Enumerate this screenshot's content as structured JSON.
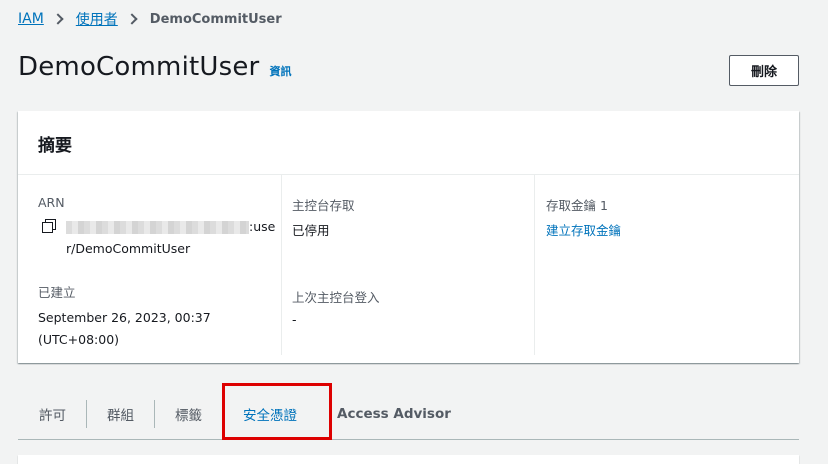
{
  "breadcrumb": {
    "root": "IAM",
    "users": "使用者",
    "current": "DemoCommitUser"
  },
  "header": {
    "title": "DemoCommitUser",
    "info": "資訊",
    "delete_label": "刪除"
  },
  "summary": {
    "title": "摘要",
    "arn_label": "ARN",
    "arn_suffix_1": ":use",
    "arn_suffix_2": "r/DemoCommitUser",
    "created_label": "已建立",
    "created_value_1": "September 26, 2023, 00:37",
    "created_value_2": "(UTC+08:00)",
    "console_access_label": "主控台存取",
    "console_access_value": "已停用",
    "last_login_label": "上次主控台登入",
    "last_login_value": "-",
    "access_key_label": "存取金鑰 1",
    "access_key_link": "建立存取金鑰"
  },
  "tabs": [
    {
      "label": "許可"
    },
    {
      "label": "群組"
    },
    {
      "label": "標籤"
    },
    {
      "label": "安全憑證"
    },
    {
      "label": "Access Advisor"
    }
  ],
  "colors": {
    "link": "#0073bb",
    "highlight": "#dd0000",
    "background": "#f2f3f3"
  }
}
